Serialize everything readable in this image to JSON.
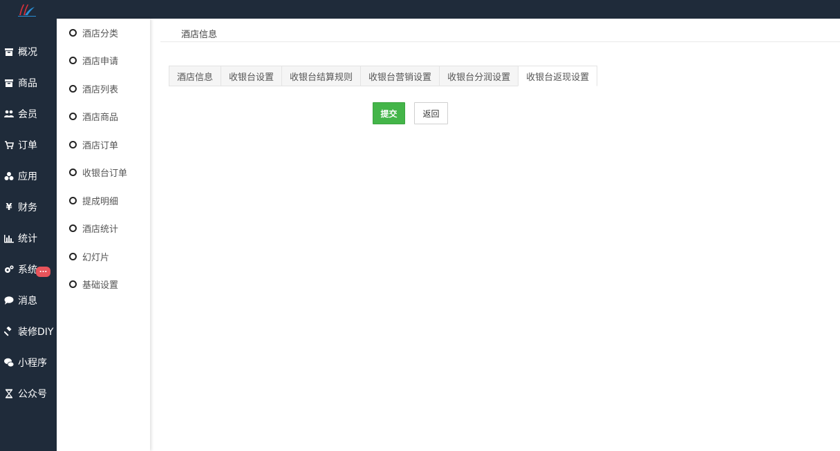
{
  "sidebar": {
    "items": [
      {
        "label": "概况",
        "icon": "archive-icon"
      },
      {
        "label": "商品",
        "icon": "archive-icon"
      },
      {
        "label": "会员",
        "icon": "users-icon"
      },
      {
        "label": "订单",
        "icon": "cart-icon"
      },
      {
        "label": "应用",
        "icon": "cubes-icon"
      },
      {
        "label": "财务",
        "icon": "yen-icon"
      },
      {
        "label": "统计",
        "icon": "bar-chart-icon"
      },
      {
        "label": "系统",
        "icon": "gears-icon"
      },
      {
        "label": "消息",
        "icon": "comment-icon"
      },
      {
        "label": "装修DIY",
        "icon": "gavel-icon"
      },
      {
        "label": "小程序",
        "icon": "wechat-icon"
      },
      {
        "label": "公众号",
        "icon": "hourglass-icon"
      }
    ],
    "message_badge": "..."
  },
  "subnav": {
    "items": [
      "酒店分类",
      "酒店申请",
      "酒店列表",
      "酒店商品",
      "酒店订单",
      "收银台订单",
      "提成明细",
      "酒店统计",
      "幻灯片",
      "基础设置"
    ]
  },
  "main": {
    "breadcrumb": "酒店信息",
    "tabs": [
      "酒店信息",
      "收银台设置",
      "收银台结算规则",
      "收银台营销设置",
      "收银台分润设置",
      "收银台返现设置"
    ],
    "submit_label": "提交",
    "back_label": "返回"
  },
  "colors": {
    "sidebar_bg": "#1f2b3a",
    "submit_green": "#44b549",
    "badge_red": "#e9545b"
  }
}
